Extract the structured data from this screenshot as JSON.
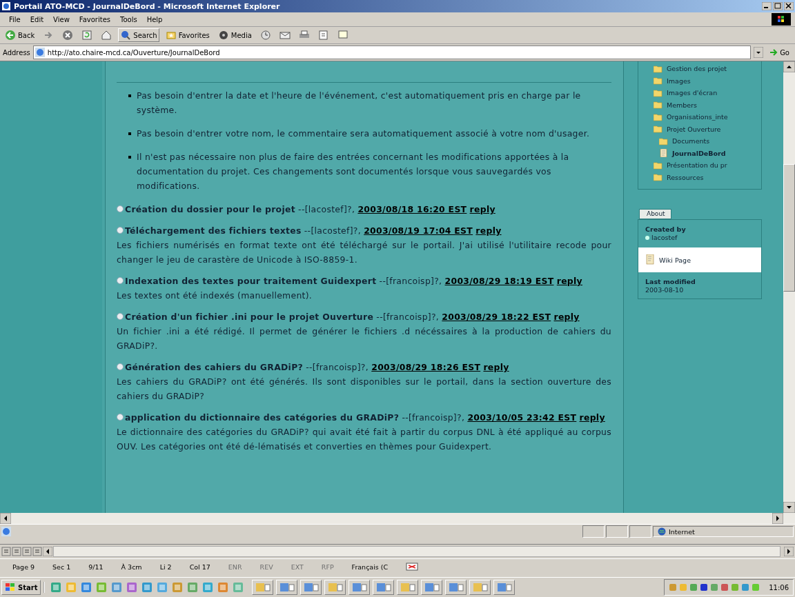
{
  "window": {
    "title": "Portail ATO-MCD - JournalDeBord - Microsoft Internet Explorer"
  },
  "menu": [
    "File",
    "Edit",
    "View",
    "Favorites",
    "Tools",
    "Help"
  ],
  "toolbar": [
    {
      "kind": "back",
      "label": "Back"
    },
    {
      "kind": "forward"
    },
    {
      "kind": "stop"
    },
    {
      "kind": "refresh"
    },
    {
      "kind": "home"
    },
    {
      "kind": "search",
      "label": "Search"
    },
    {
      "kind": "favorites",
      "label": "Favorites"
    },
    {
      "kind": "media",
      "label": "Media"
    },
    {
      "kind": "history"
    },
    {
      "kind": "mail"
    },
    {
      "kind": "print"
    },
    {
      "kind": "edit"
    },
    {
      "kind": "discuss"
    }
  ],
  "address": {
    "label": "Address",
    "value": "http://ato.chaire-mcd.ca/Ouverture/JournalDeBord",
    "go": "Go"
  },
  "notes": [
    "Pas besoin d'entrer la date et l'heure de l'événement, c'est automatiquement pris en charge par le système.",
    "Pas besoin d'entrer votre nom, le commentaire sera automatiquement associé à votre nom d'usager.",
    "Il n'est pas nécessaire non plus de faire des entrées concernant les modifications apportées à la documentation du projet. Ces changements sont documentés lorsque vous sauvegardés vos modifications."
  ],
  "entries": [
    {
      "title": "Création du dossier pour le projet",
      "author": "--[lacostef]?,",
      "date": "2003/08/18 16:20 EST",
      "reply": "reply"
    },
    {
      "title": "Téléchargement des fichiers textes",
      "author": "--[lacostef]?,",
      "date": "2003/08/19 17:04 EST",
      "reply": "reply",
      "body": "Les fichiers numérisés en format texte ont été téléchargé sur le portail. J'ai utilisé l'utilitaire recode pour changer le jeu de carastère de Unicode à ISO-8859-1."
    },
    {
      "title": "Indexation des textes pour traitement Guidexpert",
      "author": "--[francoisp]?,",
      "date": "2003/08/29 18:19 EST",
      "reply": "reply",
      "body": "Les textes ont été indexés (manuellement)."
    },
    {
      "title": "Création d'un fichier .ini pour le projet Ouverture",
      "author": "--[francoisp]?,",
      "date": "2003/08/29 18:22 EST",
      "reply": "reply",
      "body": "Un fichier .ini a été rédigé. Il permet de générer le fichiers .d nécéssaires à la production de cahiers du GRADiP?."
    },
    {
      "title": "Génération des cahiers du GRADiP?",
      "author": "--[francoisp]?,",
      "date": "2003/08/29 18:26 EST",
      "reply": "reply",
      "body": "Les cahiers du GRADiP? ont été générés. Ils sont disponibles sur le portail, dans la section ouverture des cahiers du GRADiP?"
    },
    {
      "title": "application du dictionnaire des catégories du GRADiP?",
      "author": "--[francoisp]?,",
      "date": "2003/10/05 23:42 EST",
      "reply": "reply",
      "body": "Le dictionnaire des catégories du GRADiP? qui avait été fait à partir du corpus DNL à été appliqué au corpus OUV. Les catégories ont été dé-lématisés et converties en thèmes pour Guidexpert."
    }
  ],
  "sidebar": {
    "tree": [
      {
        "label": "Gestion des projet",
        "kind": "folder",
        "selected": false
      },
      {
        "label": "Images",
        "kind": "folder",
        "selected": false
      },
      {
        "label": "Images d'écran",
        "kind": "folder",
        "selected": false
      },
      {
        "label": "Members",
        "kind": "folder",
        "selected": false
      },
      {
        "label": "Organisations_inte",
        "kind": "folder",
        "selected": false
      },
      {
        "label": "Projet Ouverture",
        "kind": "folder",
        "selected": false,
        "children": [
          {
            "label": "Documents",
            "kind": "folder",
            "selected": false
          },
          {
            "label": "JournalDeBord",
            "kind": "page",
            "selected": true
          }
        ]
      },
      {
        "label": "Présentation du pr",
        "kind": "folder",
        "selected": false
      },
      {
        "label": "Ressources",
        "kind": "folder",
        "selected": false
      }
    ],
    "about": {
      "tab": "About",
      "created_label": "Created by",
      "creator": "lacostef",
      "type": "Wiki Page",
      "modified_label": "Last modified",
      "modified": "2003-08-10"
    }
  },
  "status_bar": {
    "zone": "Internet"
  },
  "word_status": [
    {
      "text": "Page 9",
      "disabled": false
    },
    {
      "text": "Sec 1",
      "disabled": false
    },
    {
      "text": "9/11",
      "disabled": false
    },
    {
      "text": "À 3cm",
      "disabled": false
    },
    {
      "text": "Li 2",
      "disabled": false
    },
    {
      "text": "Col 17",
      "disabled": false
    },
    {
      "text": "ENR",
      "disabled": true
    },
    {
      "text": "REV",
      "disabled": true
    },
    {
      "text": "EXT",
      "disabled": true
    },
    {
      "text": "RFP",
      "disabled": true
    },
    {
      "text": "Français (C",
      "disabled": false
    }
  ],
  "taskbar": {
    "start": "Start",
    "clock": "11:06"
  }
}
